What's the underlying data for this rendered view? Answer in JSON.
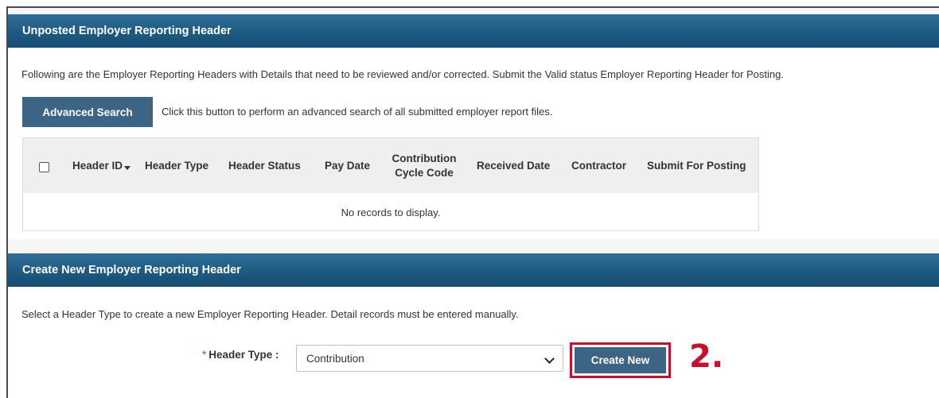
{
  "unposted_panel": {
    "title": "Unposted Employer Reporting Header",
    "description": "Following are the Employer Reporting Headers with Details that need to be reviewed and/or corrected. Submit the Valid status Employer Reporting Header for Posting.",
    "advanced_search_label": "Advanced Search",
    "advanced_search_hint": "Click this button to perform an advanced search of all submitted employer report files.",
    "table": {
      "columns": [
        "Header ID",
        "Header Type",
        "Header Status",
        "Pay Date",
        "Contribution Cycle Code",
        "Received Date",
        "Contractor",
        "Submit For Posting"
      ],
      "contribution_line1": "Contribution",
      "contribution_line2": "Cycle Code",
      "empty_message": "No records to display."
    }
  },
  "create_panel": {
    "title": "Create New Employer Reporting Header",
    "description": "Select a Header Type to create a new Employer Reporting Header. Detail records must be entered manually.",
    "required_marker": "*",
    "header_type_label": "Header Type :",
    "header_type_value": "Contribution",
    "create_new_label": "Create New",
    "step_label": "2."
  },
  "colors": {
    "header_bar": "#1d5a82",
    "button": "#3c6485",
    "highlight": "#c8102e"
  }
}
